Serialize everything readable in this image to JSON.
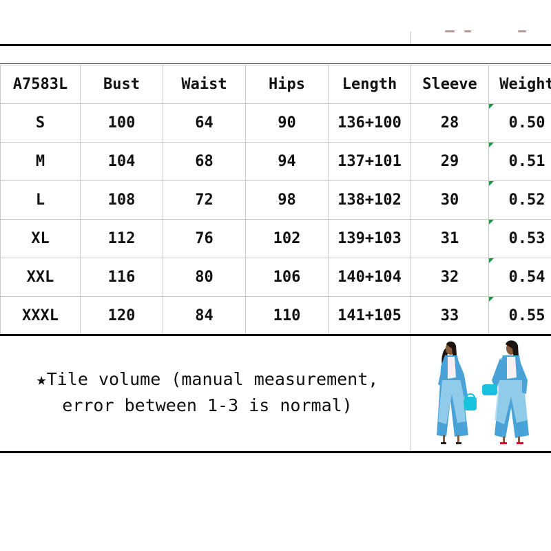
{
  "table": {
    "headers": [
      "A7583L",
      "Bust",
      "Waist",
      "Hips",
      "Length",
      "Sleeve",
      "Weight"
    ],
    "rows": [
      [
        "S",
        "100",
        "64",
        "90",
        "136+100",
        "28",
        "0.50"
      ],
      [
        "M",
        "104",
        "68",
        "94",
        "137+101",
        "29",
        "0.51"
      ],
      [
        "L",
        "108",
        "72",
        "98",
        "138+102",
        "30",
        "0.52"
      ],
      [
        "XL",
        "112",
        "76",
        "102",
        "139+103",
        "31",
        "0.53"
      ],
      [
        "XXL",
        "116",
        "80",
        "106",
        "140+104",
        "32",
        "0.54"
      ],
      [
        "XXXL",
        "120",
        "84",
        "110",
        "141+105",
        "33",
        "0.55"
      ]
    ]
  },
  "note": {
    "line1": "★Tile volume (manual measurement,",
    "line2": "error between 1-3 is normal)"
  },
  "colors": {
    "outfit": "#4aa3d8",
    "outfit_light": "#a9d8f0",
    "skin": "#8a5a3c",
    "hair": "#1b1410",
    "bag": "#19c2dc",
    "flag": "#1a9a3a"
  },
  "images": {
    "model_photo": "two-models-blue-printed-long-cardigan"
  }
}
